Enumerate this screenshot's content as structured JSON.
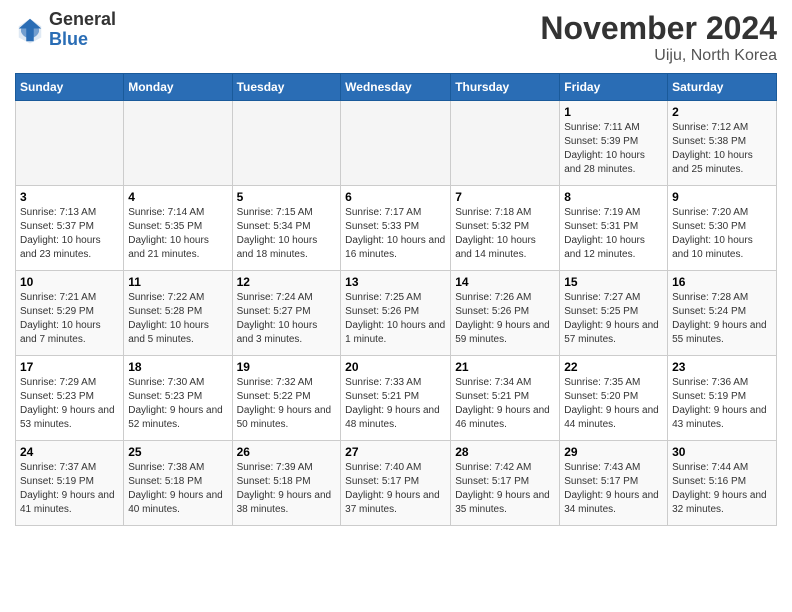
{
  "header": {
    "logo_general": "General",
    "logo_blue": "Blue",
    "title": "November 2024",
    "location": "Uiju, North Korea"
  },
  "calendar": {
    "days_of_week": [
      "Sunday",
      "Monday",
      "Tuesday",
      "Wednesday",
      "Thursday",
      "Friday",
      "Saturday"
    ],
    "weeks": [
      [
        {
          "day": "",
          "info": ""
        },
        {
          "day": "",
          "info": ""
        },
        {
          "day": "",
          "info": ""
        },
        {
          "day": "",
          "info": ""
        },
        {
          "day": "",
          "info": ""
        },
        {
          "day": "1",
          "info": "Sunrise: 7:11 AM\nSunset: 5:39 PM\nDaylight: 10 hours and 28 minutes."
        },
        {
          "day": "2",
          "info": "Sunrise: 7:12 AM\nSunset: 5:38 PM\nDaylight: 10 hours and 25 minutes."
        }
      ],
      [
        {
          "day": "3",
          "info": "Sunrise: 7:13 AM\nSunset: 5:37 PM\nDaylight: 10 hours and 23 minutes."
        },
        {
          "day": "4",
          "info": "Sunrise: 7:14 AM\nSunset: 5:35 PM\nDaylight: 10 hours and 21 minutes."
        },
        {
          "day": "5",
          "info": "Sunrise: 7:15 AM\nSunset: 5:34 PM\nDaylight: 10 hours and 18 minutes."
        },
        {
          "day": "6",
          "info": "Sunrise: 7:17 AM\nSunset: 5:33 PM\nDaylight: 10 hours and 16 minutes."
        },
        {
          "day": "7",
          "info": "Sunrise: 7:18 AM\nSunset: 5:32 PM\nDaylight: 10 hours and 14 minutes."
        },
        {
          "day": "8",
          "info": "Sunrise: 7:19 AM\nSunset: 5:31 PM\nDaylight: 10 hours and 12 minutes."
        },
        {
          "day": "9",
          "info": "Sunrise: 7:20 AM\nSunset: 5:30 PM\nDaylight: 10 hours and 10 minutes."
        }
      ],
      [
        {
          "day": "10",
          "info": "Sunrise: 7:21 AM\nSunset: 5:29 PM\nDaylight: 10 hours and 7 minutes."
        },
        {
          "day": "11",
          "info": "Sunrise: 7:22 AM\nSunset: 5:28 PM\nDaylight: 10 hours and 5 minutes."
        },
        {
          "day": "12",
          "info": "Sunrise: 7:24 AM\nSunset: 5:27 PM\nDaylight: 10 hours and 3 minutes."
        },
        {
          "day": "13",
          "info": "Sunrise: 7:25 AM\nSunset: 5:26 PM\nDaylight: 10 hours and 1 minute."
        },
        {
          "day": "14",
          "info": "Sunrise: 7:26 AM\nSunset: 5:26 PM\nDaylight: 9 hours and 59 minutes."
        },
        {
          "day": "15",
          "info": "Sunrise: 7:27 AM\nSunset: 5:25 PM\nDaylight: 9 hours and 57 minutes."
        },
        {
          "day": "16",
          "info": "Sunrise: 7:28 AM\nSunset: 5:24 PM\nDaylight: 9 hours and 55 minutes."
        }
      ],
      [
        {
          "day": "17",
          "info": "Sunrise: 7:29 AM\nSunset: 5:23 PM\nDaylight: 9 hours and 53 minutes."
        },
        {
          "day": "18",
          "info": "Sunrise: 7:30 AM\nSunset: 5:23 PM\nDaylight: 9 hours and 52 minutes."
        },
        {
          "day": "19",
          "info": "Sunrise: 7:32 AM\nSunset: 5:22 PM\nDaylight: 9 hours and 50 minutes."
        },
        {
          "day": "20",
          "info": "Sunrise: 7:33 AM\nSunset: 5:21 PM\nDaylight: 9 hours and 48 minutes."
        },
        {
          "day": "21",
          "info": "Sunrise: 7:34 AM\nSunset: 5:21 PM\nDaylight: 9 hours and 46 minutes."
        },
        {
          "day": "22",
          "info": "Sunrise: 7:35 AM\nSunset: 5:20 PM\nDaylight: 9 hours and 44 minutes."
        },
        {
          "day": "23",
          "info": "Sunrise: 7:36 AM\nSunset: 5:19 PM\nDaylight: 9 hours and 43 minutes."
        }
      ],
      [
        {
          "day": "24",
          "info": "Sunrise: 7:37 AM\nSunset: 5:19 PM\nDaylight: 9 hours and 41 minutes."
        },
        {
          "day": "25",
          "info": "Sunrise: 7:38 AM\nSunset: 5:18 PM\nDaylight: 9 hours and 40 minutes."
        },
        {
          "day": "26",
          "info": "Sunrise: 7:39 AM\nSunset: 5:18 PM\nDaylight: 9 hours and 38 minutes."
        },
        {
          "day": "27",
          "info": "Sunrise: 7:40 AM\nSunset: 5:17 PM\nDaylight: 9 hours and 37 minutes."
        },
        {
          "day": "28",
          "info": "Sunrise: 7:42 AM\nSunset: 5:17 PM\nDaylight: 9 hours and 35 minutes."
        },
        {
          "day": "29",
          "info": "Sunrise: 7:43 AM\nSunset: 5:17 PM\nDaylight: 9 hours and 34 minutes."
        },
        {
          "day": "30",
          "info": "Sunrise: 7:44 AM\nSunset: 5:16 PM\nDaylight: 9 hours and 32 minutes."
        }
      ]
    ]
  }
}
